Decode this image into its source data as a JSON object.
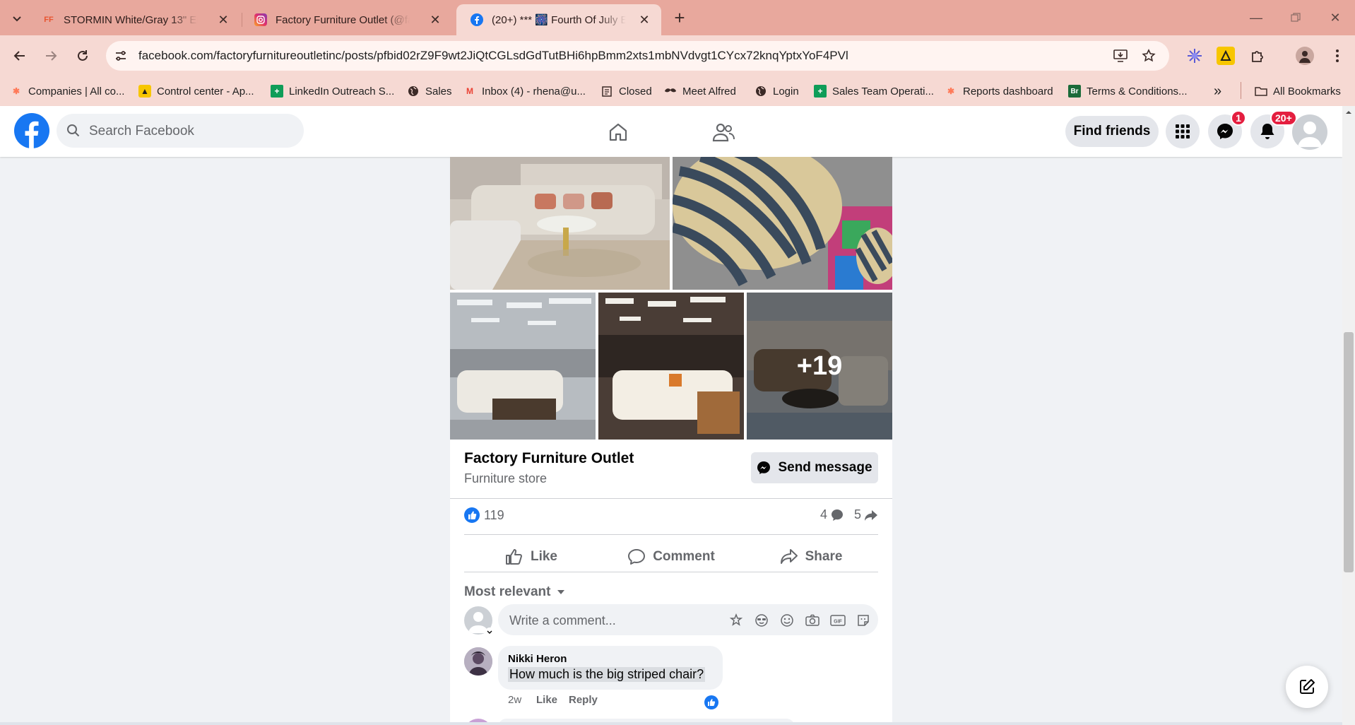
{
  "browser": {
    "tabs": [
      {
        "title": "STORMIN White/Gray 13\" Euro",
        "favicon": "FF",
        "active": false
      },
      {
        "title": "Factory Furniture Outlet (@factory",
        "favicon": "instagram",
        "active": false
      },
      {
        "title": "(20+) *** 🎆 Fourth Of July Early",
        "favicon": "facebook",
        "active": true
      }
    ],
    "url": "facebook.com/factoryfurnitureoutletinc/posts/pfbid02rZ9F9wt2JiQtCGLsdGdTutBHi6hpBmm2xts1mbNVdvgt1CYcx72knqYptxYoF4PVl",
    "bookmarks": [
      {
        "label": "Companies | All co...",
        "icon": "hubspot-icon"
      },
      {
        "label": "Control center - Ap...",
        "icon": "apollo-icon"
      },
      {
        "label": "LinkedIn Outreach S...",
        "icon": "sheets-icon"
      },
      {
        "label": "Sales",
        "icon": "globe-icon"
      },
      {
        "label": "Inbox (4) - rhena@u...",
        "icon": "gmail-icon"
      },
      {
        "label": "Closed",
        "icon": "clipboard-icon"
      },
      {
        "label": "Meet Alfred",
        "icon": "mustache-icon"
      },
      {
        "label": "Login",
        "icon": "globe-icon"
      },
      {
        "label": "Sales Team Operati...",
        "icon": "sheets-icon"
      },
      {
        "label": "Reports dashboard",
        "icon": "hubspot-icon"
      },
      {
        "label": "Terms & Conditions...",
        "icon": "br-icon"
      }
    ],
    "all_bookmarks": "All Bookmarks",
    "more_bookmarks": "»"
  },
  "facebook": {
    "search_placeholder": "Search Facebook",
    "find_friends": "Find friends",
    "messenger_badge": "1",
    "notifications_badge": "20+"
  },
  "post": {
    "more_photos": "+19",
    "page_name": "Factory Furniture Outlet",
    "page_category": "Furniture store",
    "send_message": "Send message",
    "like_count": "119",
    "comment_count": "4",
    "share_count": "5",
    "actions": {
      "like": "Like",
      "comment": "Comment",
      "share": "Share"
    },
    "sort_label": "Most relevant",
    "comment_placeholder": "Write a comment...",
    "comments": [
      {
        "author": "Nikki Heron",
        "text": "How much is the big striped chair?",
        "age": "2w",
        "like": "Like",
        "reply": "Reply"
      }
    ]
  },
  "colors": {
    "fb_blue": "#1877f2",
    "tabstrip": "#e8a89d",
    "toolbar": "#f6d9d3",
    "badge_red": "#e41e3f"
  }
}
